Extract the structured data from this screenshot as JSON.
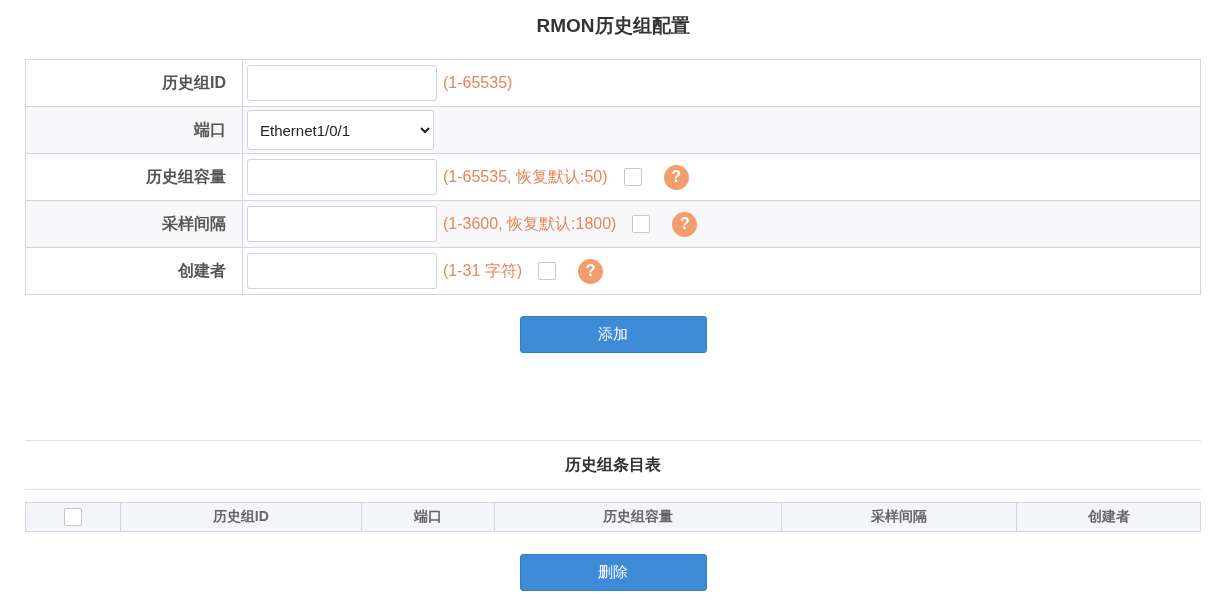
{
  "title": "RMON历史组配置",
  "form_rows": [
    {
      "kind": "text",
      "label": "历史组ID",
      "value": "",
      "hint": "(1-65535)"
    },
    {
      "kind": "select",
      "label": "端口",
      "value": "Ethernet1/0/1"
    },
    {
      "kind": "text",
      "label": "历史组容量",
      "hint": "(1-65535, 恢复默认:50)",
      "checked": false,
      "help": "?"
    },
    {
      "kind": "text",
      "label": "采样间隔",
      "hint": "(1-3600, 恢复默认:1800)",
      "checked": false,
      "help": "?"
    },
    {
      "kind": "text",
      "label": "创建者",
      "hint": "(1-31 字符)",
      "checked": false,
      "help": "?"
    }
  ],
  "add_button": "添加",
  "list_title": "历史组条目表",
  "table": {
    "select_all_checked": false,
    "columns": [
      "历史组ID",
      "端口",
      "历史组容量",
      "采样间隔",
      "创建者"
    ]
  },
  "delete_button": "删除"
}
